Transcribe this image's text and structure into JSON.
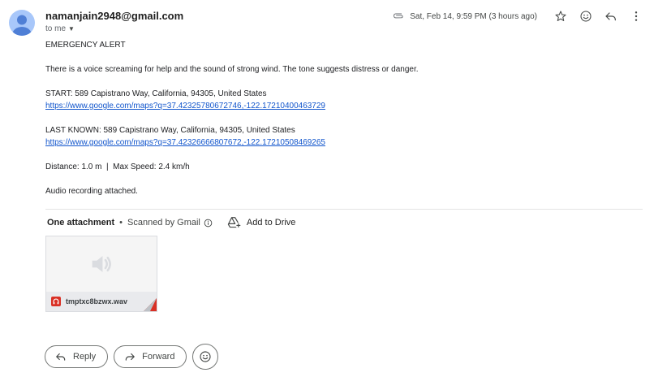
{
  "header": {
    "sender": "namanjain2948@gmail.com",
    "recipient_label": "to me",
    "date": "Sat, Feb 14, 9:59 PM (3 hours ago)"
  },
  "icons": {
    "attachment": "paperclip-icon",
    "star": "star-icon",
    "emoji": "smiley-icon",
    "reply": "reply-arrow-icon",
    "more": "more-vert-icon"
  },
  "message": {
    "line1": "EMERGENCY ALERT",
    "line2": "There is a voice screaming for help and the sound of strong wind. The tone suggests distress or danger.",
    "start_text": "START: 589 Capistrano Way, California, 94305, United States",
    "start_link": "https://www.google.com/maps?q=37.42325780672746,-122.17210400463729",
    "last_text": "LAST KNOWN: 589 Capistrano Way, California, 94305, United States",
    "last_link": "https://www.google.com/maps?q=37.42326666807672,-122.17210508469265",
    "stats": "Distance: 1.0 m  |  Max Speed: 2.4 km/h",
    "audio_note": "Audio recording attached."
  },
  "attachments": {
    "title": "One attachment",
    "scanned": "Scanned by Gmail",
    "add_to_drive": "Add to Drive",
    "file_name": "tmptxc8bzwx.wav"
  },
  "actions": {
    "reply": "Reply",
    "forward": "Forward"
  },
  "colors": {
    "link": "#1155cc",
    "avatar": "#a8c7fa",
    "avatar_figure": "#4f7fd6",
    "file_badge": "#d93025"
  }
}
